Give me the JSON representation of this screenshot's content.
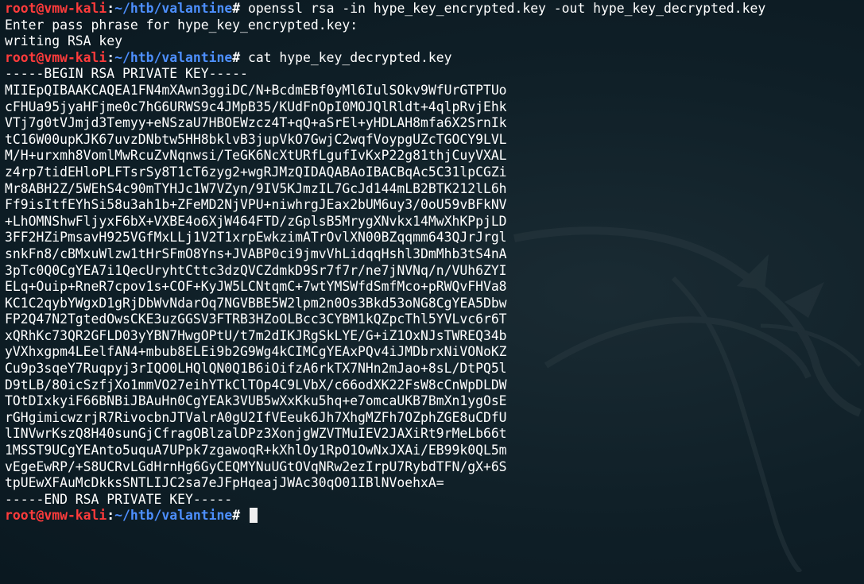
{
  "prompt": {
    "user_host": "root@vmw-kali",
    "separator": ":",
    "path": "~/htb/valantine",
    "symbol": "#"
  },
  "commands": {
    "openssl": " openssl rsa -in hype_key_encrypted.key -out hype_key_decrypted.key",
    "cat": " cat hype_key_decrypted.key"
  },
  "output": {
    "pass_prompt": "Enter pass phrase for hype_key_encrypted.key:",
    "writing": "writing RSA key",
    "key_begin": "-----BEGIN RSA PRIVATE KEY-----",
    "key_lines": [
      "MIIEpQIBAAKCAQEA1FN4mXAwn3ggiDC/N+BcdmEBf0yMl6IulSOkv9WfUrGTPTUo",
      "cFHUa95jyaHFjme0c7hG6URWS9c4JMpB35/KUdFnOpI0MOJQlRldt+4qlpRvjEhk",
      "VTj7g0tVJmjd3Temyy+eNSzaU7HBOEWzcz4T+qQ+aSrEl+yHDLAH8mfa6X2SrnIk",
      "tC16W00upKJK67uvzDNbtw5HH8bklvB3jupVkO7GwjC2wqfVoypgUZcTGOCY9LVL",
      "M/H+urxmh8VomlMwRcuZvNqnwsi/TeGK6NcXtURfLgufIvKxP22g81thjCuyVXAL",
      "z4rp7tidEHloPLFTsrSy8T1cT6zyg2+wgRJMzQIDAQABAoIBACBqAc5C31lpCGZi",
      "Mr8ABH2Z/5WEhS4c90mTYHJc1W7VZyn/9IV5KJmzIL7GcJd144mLB2BTK212lL6h",
      "Ff9isItfEYhSi58u3ah1b+ZFeMD2NjVPU+niwhrgJEax2bUM6uy3/0oU59vBFkNV",
      "+LhOMNShwFljyxF6bX+VXBE4o6XjW464FTD/zGplsB5MrygXNvkx14MwXhKPpjLD",
      "3FF2HZiPmsavH925VGfMxLLj1V2T1xrpEwkzimATrOvlXN00BZqqmm643QJrJrgl",
      "snkFn8/cBMxuWlzw1tHrSFmO8Yns+JVABP0ci9jmvVhLidqqHshl3DmMhb3tS4nA",
      "3pTc0Q0CgYEA7i1QecUryhtCttc3dzQVCZdmkD9Sr7f7r/ne7jNVNq/n/VUh6ZYI",
      "ELq+Ouip+RneR7cpov1s+COF+KyJW5LCNtqmC+7wtYMSWfdSmfMco+pRWQvFHVa8",
      "KC1C2qybYWgxD1gRjDbWvNdarOq7NGVBBE5W2lpm2n0Os3Bkd53oNG8CgYEA5Dbw",
      "FP2Q47N2TgtedOwsCKE3uzGGSV3FTRB3HZoOLBcc3CYBM1kQZpcThl5YVLvc6r6T",
      "xQRhKc73QR2GFLD03yYBN7HwgOPtU/t7m2dIKJRgSkLYE/G+iZ1OxNJsTWREQ34b",
      "yVXhxgpm4LEelfAN4+mbub8ELEi9b2G9Wg4kCIMCgYEAxPQv4iJMDbrxNiVONoKZ",
      "Cu9p3sqeY7Ruqpyj3rIQO0LHQlQN0Q1B6iOifzA6rkTX7NHn2mJao+8sL/DtPQ5l",
      "D9tLB/80icSzfjXo1mmVO27eihYTkClTOp4C9LVbX/c66odXK22FsW8cCnWpDLDW",
      "TOtDIxkyiF66BNBiJBAuHn0CgYEAk3VUB5wXxKku5hq+e7omcaUKB7BmXn1ygOsE",
      "rGHgimicwzrjR7RivocbnJTValrA0gU2IfVEeuk6Jh7XhgMZFh7OZphZGE8uCDfU",
      "lINVwrKszQ8H40sunGjCfragOBlzalDPz3XonjgWZVTMuIEV2JAXiRt9rMeLb66t",
      "1MSST9UCgYEAnto5uquA7UPpk7zgawoqR+kXhlOy1RpO1OwNxJXAi/EB99k0QL5m",
      "vEgeEwRP/+S8UCRvLGdHrnHg6GyCEQMYNuUGtOVqNRw2ezIrpU7RybdTFN/gX+6S",
      "tpUEwXFAuMcDkksSNTLIJC2sa7eJFpHqeajJWAc30qO01IBlNVoehxA="
    ],
    "key_end": "-----END RSA PRIVATE KEY-----"
  },
  "colors": {
    "prompt_user": "#ff3b3b",
    "prompt_path": "#4d8fff",
    "background": "#0f1f27",
    "text": "#ffffff"
  },
  "icons": {
    "background_logo": "kali-dragon-watermark"
  }
}
